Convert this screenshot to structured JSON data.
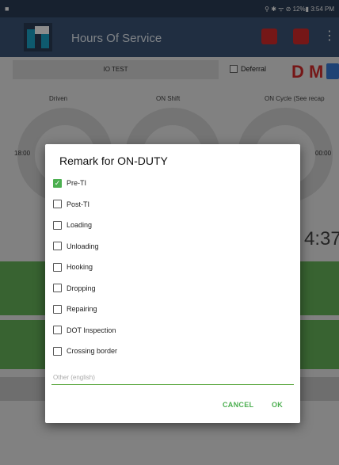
{
  "status_bar": {
    "left_icon": "■",
    "right_text": "⚲ ✱ ᯤ ⊘ 12%▮ 3:54 PM"
  },
  "app_bar": {
    "title": "Hours Of Service",
    "more_glyph": "⋮"
  },
  "sub_bar": {
    "driver": "IO TEST",
    "deferral_label": "Deferral",
    "d_label": "D",
    "m_label": "M"
  },
  "gauges": {
    "labels": [
      "Driven",
      "ON Shift",
      "ON Cycle (See recap"
    ],
    "left_value": "18:00",
    "right_value": "00:00",
    "big_time": "4:37"
  },
  "dialog": {
    "title": "Remark for ON-DUTY",
    "options": [
      {
        "label": "Pre-TI",
        "checked": true
      },
      {
        "label": "Post-TI",
        "checked": false
      },
      {
        "label": "Loading",
        "checked": false
      },
      {
        "label": "Unloading",
        "checked": false
      },
      {
        "label": "Hooking",
        "checked": false
      },
      {
        "label": "Dropping",
        "checked": false
      },
      {
        "label": "Repairing",
        "checked": false
      },
      {
        "label": "DOT Inspection",
        "checked": false
      },
      {
        "label": "Crossing border",
        "checked": false
      }
    ],
    "other_placeholder": "Other (english)",
    "other_value": "",
    "cancel_label": "CANCEL",
    "ok_label": "OK",
    "accent": "#4caf50"
  }
}
